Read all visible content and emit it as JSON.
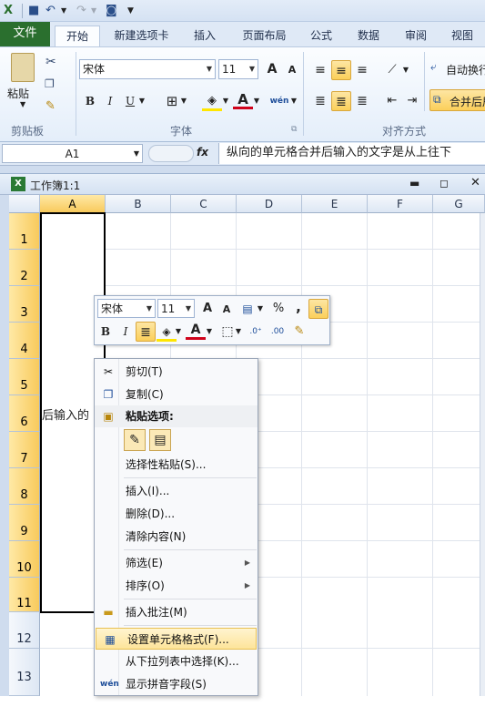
{
  "qat": {
    "undo_label": "↶",
    "redo_label": "↷"
  },
  "tabs": [
    "文件",
    "开始",
    "新建选项卡",
    "插入",
    "页面布局",
    "公式",
    "数据",
    "审阅",
    "视图"
  ],
  "ribbon": {
    "clipboard": {
      "paste": "粘贴",
      "label": "剪贴板"
    },
    "font": {
      "name": "宋体",
      "size": "11",
      "bold": "B",
      "italic": "I",
      "underline": "U",
      "grow": "A",
      "shrink": "A",
      "color": "A",
      "phonetic": "wén",
      "label": "字体"
    },
    "align": {
      "wrap": "自动换行",
      "merge": "合并后居中",
      "label": "对齐方式"
    }
  },
  "formula_bar": {
    "name_box": "A1",
    "fx": "fx",
    "formula": "纵向的单元格合并后输入的文字是从上往下"
  },
  "workbook": {
    "title": "工作簿1:1"
  },
  "grid": {
    "columns": [
      "A",
      "B",
      "C",
      "D",
      "E",
      "F",
      "G"
    ],
    "rows": [
      "1",
      "2",
      "3",
      "4",
      "5",
      "6",
      "7",
      "8",
      "9",
      "10",
      "11",
      "12",
      "13"
    ],
    "cell_text": "后输入的"
  },
  "mini_toolbar": {
    "font": "宋体",
    "size": "11",
    "bold": "B",
    "italic": "I",
    "percent": "%",
    "comma": ","
  },
  "context_menu": {
    "cut": "剪切(T)",
    "copy": "复制(C)",
    "paste_options": "粘贴选项:",
    "paste_special": "选择性粘贴(S)...",
    "insert": "插入(I)...",
    "delete": "删除(D)...",
    "clear": "清除内容(N)",
    "filter": "筛选(E)",
    "sort": "排序(O)",
    "insert_comment": "插入批注(M)",
    "format_cells": "设置单元格格式(F)...",
    "pick_list": "从下拉列表中选择(K)...",
    "phonetic": "显示拼音字段(S)"
  },
  "colors": {
    "accent": "#2a6f2e",
    "selection": "#f8ca5c",
    "highlight": "#fde49a",
    "font_red": "#d0021b"
  }
}
